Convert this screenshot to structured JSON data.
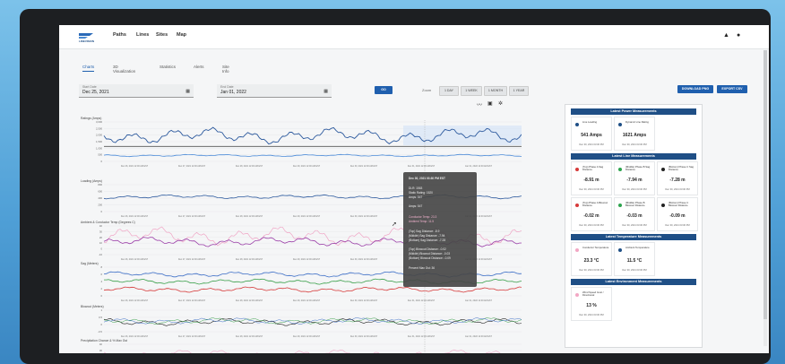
{
  "nav": {
    "logo_text": "LINEVISION",
    "items": [
      "Paths",
      "Lines",
      "Sites",
      "Map"
    ],
    "alert_icon": "warning-triangle-icon",
    "user_icon": "account-icon"
  },
  "tabs": [
    "Charts",
    "3D Visualization",
    "Statistics",
    "Alerts",
    "Site Info"
  ],
  "date_range": {
    "start_label": "Start Date",
    "start_value": "Dec 25, 2021",
    "end_label": "End Date",
    "end_value": "Jan 01, 2022",
    "go": "GO"
  },
  "zoom": {
    "label": "Zoom",
    "options": [
      "1 DAY",
      "1 WEEK",
      "1 MONTH",
      "1 YEAR"
    ]
  },
  "actions": {
    "download": "DOWNLOAD PNG",
    "export": "EXPORT CSV"
  },
  "charts": [
    {
      "title": "Ratings (Amps)",
      "yticks": [
        "3,000",
        "2,500",
        "2,000",
        "1,500",
        "1,000",
        "500",
        "0"
      ]
    },
    {
      "title": "Loading (Amps)",
      "yticks": [
        "800",
        "600",
        "400",
        "200",
        "0"
      ]
    },
    {
      "title": "Ambient & Conductor Temp (Degrees C)",
      "yticks": [
        "40",
        "30",
        "20",
        "10",
        "0",
        "-10"
      ]
    },
    {
      "title": "Sag (Meters)",
      "yticks": [
        "8",
        "6",
        "4",
        "2",
        "0"
      ]
    },
    {
      "title": "Blowout (Meters)",
      "yticks": [
        "1",
        "0.5",
        "0",
        "-0.5"
      ]
    },
    {
      "title": "Precipitation Chance & % Max Gst",
      "yticks": [
        "40",
        "30",
        "20"
      ]
    }
  ],
  "x_ticks": [
    "Dec 26, 2021 12:00 AM EST",
    "Dec 27, 2021 12:00 AM EST",
    "Dec 28, 2021 12:00 AM EST",
    "Dec 29, 2021 12:00 AM EST",
    "Dec 30, 2021 12:00 AM EST",
    "Dec 31, 2021 12:00 AM EST",
    "Jan 01, 2022 12:00 AM EST"
  ],
  "tooltip": {
    "time": "Dec 30, 2021 03:30 PM EST",
    "lines": [
      "DLR: 1563",
      "Static Rating: 1520",
      "Amps: 547",
      "Amps: 547",
      "Conductor Temp: 23.3",
      "Ambient Temp: 11.5",
      "(Top) Sag Distance: -8.9",
      "(Middle) Sag Distance: -7.94",
      "(Bottom) Sag Distance: -7.28",
      "(Top) Blowout Distance: -0.02",
      "(Middle) Blowout Distance: -0.03",
      "(Bottom) Blowout Distance: -0.09",
      "Percent Max Gst: 36"
    ]
  },
  "panel": {
    "power": {
      "title": "Latest Power Measurements",
      "items": [
        {
          "name": "Line Loading",
          "value": "541 Amps",
          "time": "Dec 30, 2021 03:30 PM",
          "color": "#1f4f86"
        },
        {
          "name": "Dynamic Line Rating",
          "value": "1621 Amps",
          "time": "Dec 30, 2021 03:30 PM",
          "color": "#1f4f86"
        }
      ]
    },
    "line": {
      "title": "Latest Line Measurements",
      "items": [
        {
          "name": "(Top) Phase A Sag Distance",
          "value": "-8.91 m",
          "time": "Dec 30, 2021 03:30 PM",
          "color": "#d63a3a"
        },
        {
          "name": "(Middle) Phase B Sag Distance",
          "value": "-7.94 m",
          "time": "Dec 30, 2021 03:30 PM",
          "color": "#2da44e"
        },
        {
          "name": "(Bottom) Phase C Sag Distance",
          "value": "-7.28 m",
          "time": "Dec 30, 2021 03:30 PM",
          "color": "#222222"
        },
        {
          "name": "(Top) Phase A Blowout Distance",
          "value": "-0.02 m",
          "time": "Dec 30, 2021 03:30 PM",
          "color": "#d63a3a"
        },
        {
          "name": "(Middle) Phase B Blowout Distance",
          "value": "-0.03 m",
          "time": "Dec 30, 2021 03:30 PM",
          "color": "#2da44e"
        },
        {
          "name": "(Bottom) Phase C Blowout Distance",
          "value": "-0.09 m",
          "time": "Dec 30, 2021 03:30 PM",
          "color": "#222222"
        }
      ]
    },
    "temp": {
      "title": "Latest Temperature Measurements",
      "items": [
        {
          "name": "Conductor Temperature",
          "value": "23.3 °C",
          "time": "Dec 30, 2021 03:30 PM",
          "color": "#f2a7c4"
        },
        {
          "name": "Ambient Temperature",
          "value": "11.5 °C",
          "time": "Dec 30, 2021 03:30 PM",
          "color": "#1f4f86"
        }
      ]
    },
    "env": {
      "title": "Latest Environment Measurements",
      "items": [
        {
          "name": "Wind Speed Gust / Directional",
          "value": "13 %",
          "time": "Dec 30, 2021 03:30 PM",
          "color": "#f2a7c4"
        }
      ]
    }
  }
}
